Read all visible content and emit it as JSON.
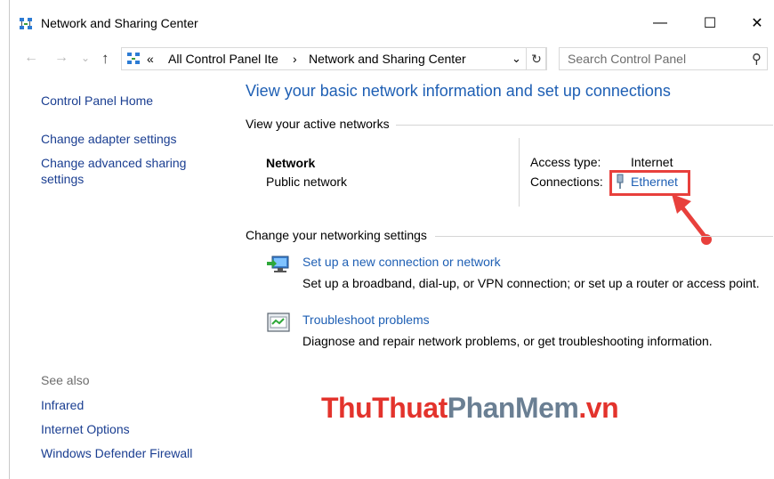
{
  "window": {
    "title": "Network and Sharing Center",
    "min_glyph": "—",
    "max_glyph": "☐",
    "close_glyph": "✕"
  },
  "nav": {
    "back_glyph": "←",
    "forward_glyph": "→",
    "recent_glyph": "⌄",
    "up_glyph": "↑",
    "overflow": "«",
    "breadcrumb": [
      "All Control Panel Ite",
      "Network and Sharing Center"
    ],
    "separator": "›",
    "dropdown_glyph": "⌄",
    "refresh_glyph": "↻",
    "search_placeholder": "Search Control Panel",
    "search_glyph": "⚲"
  },
  "left_pane": {
    "home": "Control Panel Home",
    "links": [
      "Change adapter settings",
      "Change advanced sharing",
      "settings"
    ],
    "see_also_title": "See also",
    "see_also": [
      "Infrared",
      "Internet Options",
      "Windows Defender Firewall"
    ]
  },
  "main": {
    "heading": "View your basic network information and set up connections",
    "active_section": "View your active networks",
    "network_name": "Network",
    "network_type": "Public network",
    "access_type_label": "Access type:",
    "access_type_value": "Internet",
    "connections_label": "Connections:",
    "connection_link": "Ethernet",
    "change_section": "Change your networking settings",
    "tasks": [
      {
        "title": "Set up a new connection or network",
        "desc": "Set up a broadband, dial-up, or VPN connection; or set up a router or access point.",
        "icon": "new-connection-icon"
      },
      {
        "title": "Troubleshoot problems",
        "desc": "Diagnose and repair network problems, or get troubleshooting information.",
        "icon": "troubleshoot-icon"
      }
    ]
  },
  "watermark": {
    "part1": "ThuThuat",
    "part2": "PhanMem",
    "part3": ".vn"
  },
  "colors": {
    "link": "#1e5fb4",
    "nav_link": "#1a3e91",
    "highlight": "#e8403c"
  }
}
